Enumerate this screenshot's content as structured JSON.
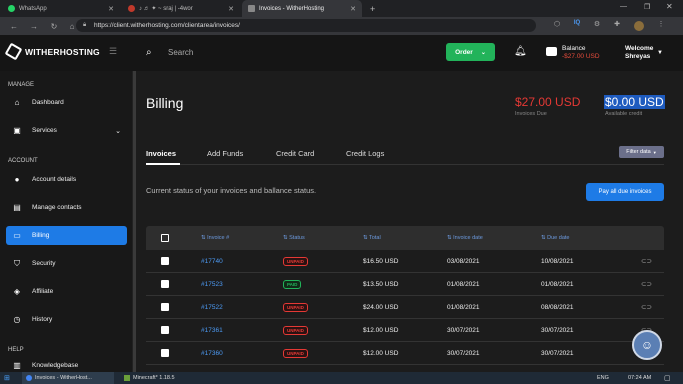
{
  "browser": {
    "tabs": [
      {
        "label": "WhatsApp",
        "active": false
      },
      {
        "label": "♪ ♬ ✦ ~ sraj | -4wor",
        "active": false
      },
      {
        "label": "Invoices - WitherHosting",
        "active": true
      }
    ],
    "new_tab": "+",
    "url": "https://client.witherhosting.com/clientarea/invoices/",
    "ext_iq": "IQ"
  },
  "header": {
    "brand": "WITHERHOSTING",
    "search_placeholder": "Search",
    "order_label": "Order",
    "balance_label": "Balance",
    "balance_value": "-$27.00 USD",
    "welcome_label": "Welcome",
    "user_name": "Shreyas"
  },
  "sidebar": {
    "manage_title": "MANAGE",
    "account_title": "ACCOUNT",
    "help_title": "HELP",
    "manage_items": [
      {
        "label": "Dashboard",
        "icon": "home-icon"
      },
      {
        "label": "Services",
        "icon": "briefcase-icon"
      }
    ],
    "account_items": [
      {
        "label": "Account details",
        "icon": "user-icon"
      },
      {
        "label": "Manage contacts",
        "icon": "contacts-icon"
      },
      {
        "label": "Billing",
        "icon": "card-icon"
      },
      {
        "label": "Security",
        "icon": "shield-icon"
      },
      {
        "label": "Affiliate",
        "icon": "tag-icon"
      },
      {
        "label": "History",
        "icon": "history-icon"
      }
    ],
    "help_items": [
      {
        "label": "Knowledgebase",
        "icon": "book-icon"
      }
    ]
  },
  "billing": {
    "title": "Billing",
    "due_amount": "$27.00 USD",
    "due_label": "Invoices Due",
    "credit_amount": "$0.00 USD",
    "credit_label": "Available credit",
    "tabs": [
      "Invoices",
      "Add Funds",
      "Credit Card",
      "Credit Logs"
    ],
    "filter_label": "Filter data",
    "status_text": "Current status of your invoices and ballance status.",
    "pay_all_label": "Pay all due invoices"
  },
  "table": {
    "headers": [
      "Invoice #",
      "Status",
      "Total",
      "Invoice date",
      "Due date"
    ],
    "rows": [
      {
        "invoice": "#17740",
        "status": "UNPAID",
        "total": "$16.50 USD",
        "date": "03/08/2021",
        "due": "10/08/2021"
      },
      {
        "invoice": "#17523",
        "status": "PAID",
        "total": "$13.50 USD",
        "date": "01/08/2021",
        "due": "01/08/2021"
      },
      {
        "invoice": "#17522",
        "status": "UNPAID",
        "total": "$24.00 USD",
        "date": "01/08/2021",
        "due": "08/08/2021"
      },
      {
        "invoice": "#17361",
        "status": "UNPAID",
        "total": "$12.00 USD",
        "date": "30/07/2021",
        "due": "30/07/2021"
      },
      {
        "invoice": "#17360",
        "status": "UNPAID",
        "total": "$12.00 USD",
        "date": "30/07/2021",
        "due": "30/07/2021"
      }
    ]
  },
  "taskbar": {
    "app1": "Invoices - WitherHost...",
    "app2": "Minecraft* 1.18.5",
    "lang": "ENG",
    "time": "07:24 AM"
  },
  "colors": {
    "accent": "#1e7be6",
    "order_green": "#22b35a",
    "danger": "#e53935"
  }
}
